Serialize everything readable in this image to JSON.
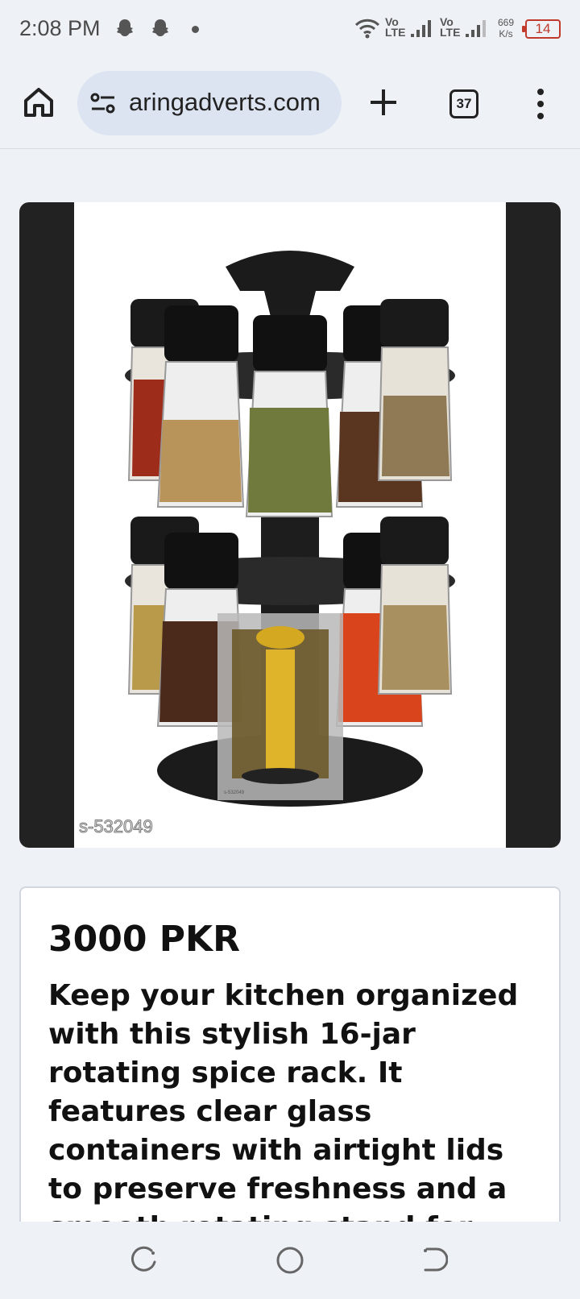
{
  "status_bar": {
    "time": "2:08 PM",
    "notification_icons": [
      "snapchat-icon",
      "snapchat-icon"
    ],
    "network_1": "Vo LTE",
    "network_2": "Vo LTE",
    "speed_value": "669",
    "speed_unit": "K/s",
    "battery": "14"
  },
  "browser": {
    "url": "aringadverts.com",
    "tab_count": "37",
    "icons": [
      "home-icon",
      "site-settings-icon",
      "plus-icon",
      "tab-switcher-icon",
      "more-vert-icon"
    ]
  },
  "product": {
    "image_watermark": "s-532049",
    "thumbnail_caption": "s-532049",
    "price": "3000 PKR",
    "description": "Keep your kitchen organized with this stylish 16-jar rotating spice rack. It features clear glass containers with airtight lids to preserve freshness and a smooth rotating stand for"
  },
  "colors": {
    "background": "#eef1f6",
    "urlbar": "#dde4f1",
    "battery_low": "#c0392b"
  },
  "nav_bar": {
    "icons": [
      "recent-apps-icon",
      "home-circle-icon",
      "back-icon"
    ]
  }
}
